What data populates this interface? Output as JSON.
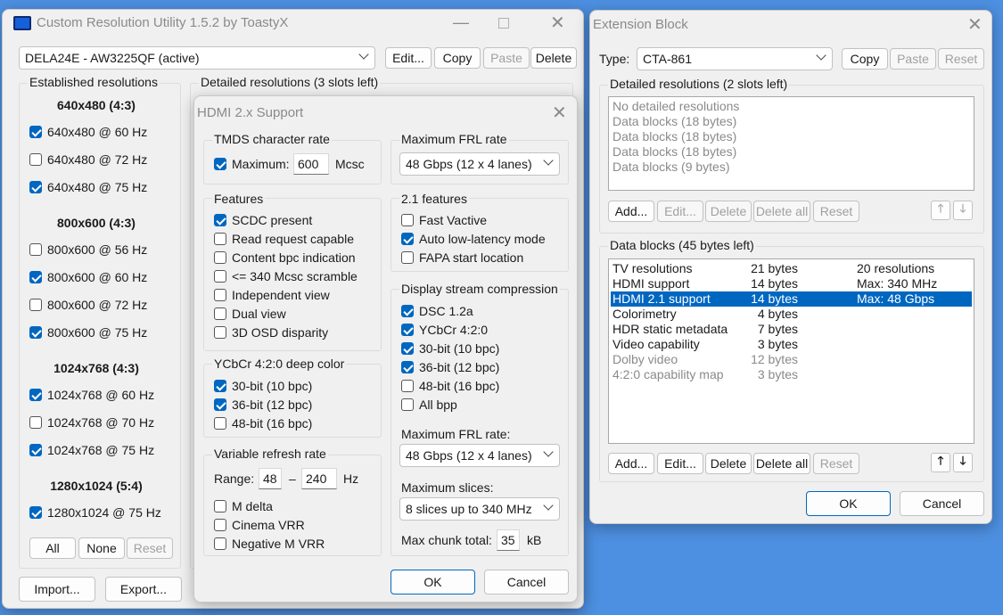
{
  "main": {
    "title": "Custom Resolution Utility 1.5.2 by ToastyX",
    "monitor": "DELA24E - AW3225QF (active)",
    "buttons": {
      "edit": "Edit...",
      "copy": "Copy",
      "paste": "Paste",
      "delete": "Delete",
      "all": "All",
      "none": "None",
      "reset": "Reset",
      "import": "Import...",
      "export": "Export..."
    },
    "established_label": "Established resolutions",
    "detailed_label": "Detailed resolutions (3 slots left)",
    "groups": [
      {
        "header": "640x480 (4:3)",
        "items": [
          {
            "label": "640x480 @ 60 Hz",
            "checked": true
          },
          {
            "label": "640x480 @ 72 Hz",
            "checked": false
          },
          {
            "label": "640x480 @ 75 Hz",
            "checked": true
          }
        ]
      },
      {
        "header": "800x600 (4:3)",
        "items": [
          {
            "label": "800x600 @ 56 Hz",
            "checked": false
          },
          {
            "label": "800x600 @ 60 Hz",
            "checked": true
          },
          {
            "label": "800x600 @ 72 Hz",
            "checked": false
          },
          {
            "label": "800x600 @ 75 Hz",
            "checked": true
          }
        ]
      },
      {
        "header": "1024x768 (4:3)",
        "items": [
          {
            "label": "1024x768 @ 60 Hz",
            "checked": true
          },
          {
            "label": "1024x768 @ 70 Hz",
            "checked": false
          },
          {
            "label": "1024x768 @ 75 Hz",
            "checked": true
          }
        ]
      },
      {
        "header": "1280x1024 (5:4)",
        "items": [
          {
            "label": "1280x1024 @ 75 Hz",
            "checked": true
          }
        ]
      }
    ]
  },
  "hdmi": {
    "title": "HDMI 2.x Support",
    "tmds": {
      "label": "TMDS character rate",
      "max_label": "Maximum:",
      "value": "600",
      "unit": "Mcsc",
      "checked": true
    },
    "features": {
      "label": "Features",
      "items": [
        {
          "label": "SCDC present",
          "checked": true
        },
        {
          "label": "Read request capable",
          "checked": false
        },
        {
          "label": "Content bpc indication",
          "checked": false
        },
        {
          "label": "<= 340 Mcsc scramble",
          "checked": false
        },
        {
          "label": "Independent view",
          "checked": false
        },
        {
          "label": "Dual view",
          "checked": false
        },
        {
          "label": "3D OSD disparity",
          "checked": false
        }
      ]
    },
    "deep_color": {
      "label": "YCbCr 4:2:0 deep color",
      "items": [
        {
          "label": "30-bit (10 bpc)",
          "checked": true
        },
        {
          "label": "36-bit (12 bpc)",
          "checked": true
        },
        {
          "label": "48-bit (16 bpc)",
          "checked": false
        }
      ]
    },
    "vrr": {
      "label": "Variable refresh rate",
      "range_label": "Range:",
      "min": "48",
      "dash": "–",
      "max": "240",
      "unit": "Hz",
      "items": [
        {
          "label": "M delta",
          "checked": false
        },
        {
          "label": "Cinema VRR",
          "checked": false
        },
        {
          "label": "Negative M VRR",
          "checked": false
        }
      ]
    },
    "frl": {
      "label": "Maximum FRL rate",
      "value": "48 Gbps (12 x 4 lanes)"
    },
    "features21": {
      "label": "2.1 features",
      "items": [
        {
          "label": "Fast Vactive",
          "checked": false
        },
        {
          "label": "Auto low-latency mode",
          "checked": true
        },
        {
          "label": "FAPA start location",
          "checked": false
        }
      ]
    },
    "dsc": {
      "label": "Display stream compression",
      "items": [
        {
          "label": "DSC 1.2a",
          "checked": true
        },
        {
          "label": "YCbCr 4:2:0",
          "checked": true
        },
        {
          "label": "30-bit (10 bpc)",
          "checked": true
        },
        {
          "label": "36-bit (12 bpc)",
          "checked": true
        },
        {
          "label": "48-bit (16 bpc)",
          "checked": false
        },
        {
          "label": "All bpp",
          "checked": false
        }
      ],
      "frl_label": "Maximum FRL rate:",
      "frl_value": "48 Gbps (12 x 4 lanes)",
      "slices_label": "Maximum slices:",
      "slices_value": "8 slices up to 340 MHz",
      "chunk_label": "Max chunk total:",
      "chunk_value": "35",
      "chunk_unit": "kB"
    },
    "ok": "OK",
    "cancel": "Cancel"
  },
  "ext": {
    "title": "Extension Block",
    "type_label": "Type:",
    "type_value": "CTA-861",
    "buttons": {
      "copy": "Copy",
      "paste": "Paste",
      "reset": "Reset",
      "add": "Add...",
      "edit": "Edit...",
      "delete": "Delete",
      "delete_all": "Delete all",
      "ok": "OK",
      "cancel": "Cancel"
    },
    "detailed_label": "Detailed resolutions (2 slots left)",
    "detailed_items": [
      "No detailed resolutions",
      "Data blocks (18 bytes)",
      "Data blocks (18 bytes)",
      "Data blocks (18 bytes)",
      "Data blocks (9 bytes)"
    ],
    "data_label": "Data blocks (45 bytes left)",
    "data_rows": [
      {
        "name": "TV resolutions",
        "size": "21 bytes",
        "info": "20 resolutions",
        "state": "normal"
      },
      {
        "name": "HDMI support",
        "size": "14 bytes",
        "info": "Max: 340 MHz",
        "state": "normal"
      },
      {
        "name": "HDMI 2.1 support",
        "size": "14 bytes",
        "info": "Max: 48 Gbps",
        "state": "selected"
      },
      {
        "name": "Colorimetry",
        "size": "4 bytes",
        "info": "",
        "state": "normal"
      },
      {
        "name": "HDR static metadata",
        "size": "7 bytes",
        "info": "",
        "state": "normal"
      },
      {
        "name": "Video capability",
        "size": "3 bytes",
        "info": "",
        "state": "normal"
      },
      {
        "name": "Dolby video",
        "size": "12 bytes",
        "info": "",
        "state": "gray"
      },
      {
        "name": "4:2:0 capability map",
        "size": "3 bytes",
        "info": "",
        "state": "gray"
      }
    ]
  }
}
